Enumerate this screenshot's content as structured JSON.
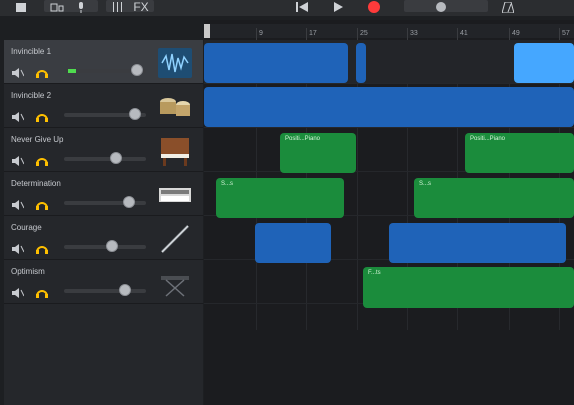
{
  "toolbar": {
    "fx_label": "FX",
    "accent": "#ff3b3b"
  },
  "ruler": {
    "labels": [
      "9",
      "17",
      "25",
      "33",
      "41",
      "49",
      "57"
    ]
  },
  "tracks": [
    {
      "name": "Invincible 1",
      "instrument": "waveform-icon",
      "volume": 0.88,
      "selected": true,
      "meter": true
    },
    {
      "name": "Invincible 2",
      "instrument": "drums-icon",
      "volume": 0.85,
      "selected": false,
      "meter": false
    },
    {
      "name": "Never Give Up",
      "instrument": "piano-icon",
      "volume": 0.6,
      "selected": false,
      "meter": false
    },
    {
      "name": "Determination",
      "instrument": "synth-icon",
      "volume": 0.78,
      "selected": false,
      "meter": false
    },
    {
      "name": "Courage",
      "instrument": "flute-icon",
      "volume": 0.55,
      "selected": false,
      "meter": false
    },
    {
      "name": "Optimism",
      "instrument": "keyboard-stand-icon",
      "volume": 0.72,
      "selected": false,
      "meter": false
    }
  ],
  "regions": [
    {
      "lane": 0,
      "kind": "audio",
      "label": ""
    },
    {
      "lane": 0,
      "kind": "audio",
      "label": ""
    },
    {
      "lane": 0,
      "kind": "audio-light",
      "label": ""
    },
    {
      "lane": 1,
      "kind": "audio",
      "label": ""
    },
    {
      "lane": 2,
      "kind": "midi",
      "label": "Positi...Piano"
    },
    {
      "lane": 2,
      "kind": "midi",
      "label": "Positi...Piano"
    },
    {
      "lane": 3,
      "kind": "midi",
      "label": "S...s"
    },
    {
      "lane": 3,
      "kind": "midi",
      "label": "S...s"
    },
    {
      "lane": 4,
      "kind": "audio",
      "label": ""
    },
    {
      "lane": 4,
      "kind": "audio",
      "label": ""
    },
    {
      "lane": 5,
      "kind": "midi",
      "label": "F...ts"
    }
  ]
}
